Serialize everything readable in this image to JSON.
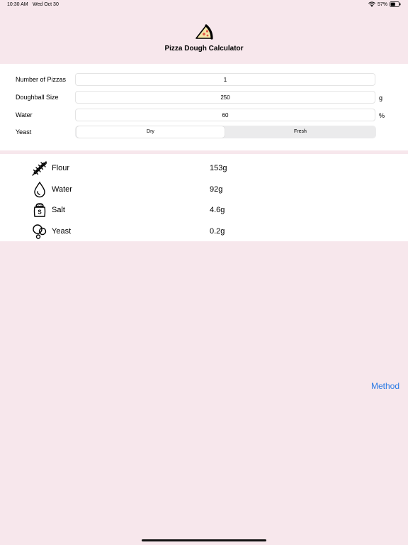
{
  "status_bar": {
    "time": "10:30 AM",
    "date": "Wed Oct 30",
    "battery": "57%",
    "battery_level": 0.57
  },
  "header": {
    "logo_icon": "pizza-slice-icon",
    "title": "Pizza Dough Calculator"
  },
  "form": {
    "pizzas": {
      "label": "Number of Pizzas",
      "value": "1"
    },
    "doughball": {
      "label": "Doughball Size",
      "value": "250",
      "unit": "g"
    },
    "water": {
      "label": "Water",
      "value": "60",
      "unit": "%"
    },
    "yeast": {
      "label": "Yeast",
      "options": [
        "Dry",
        "Fresh"
      ],
      "selected": "Dry"
    }
  },
  "results": [
    {
      "icon": "wheat-icon",
      "name": "Flour",
      "value": "153g"
    },
    {
      "icon": "water-drop-icon",
      "name": "Water",
      "value": "92g"
    },
    {
      "icon": "salt-shaker-icon",
      "name": "Salt",
      "value": "4.6g"
    },
    {
      "icon": "yeast-bubbles-icon",
      "name": "Yeast",
      "value": "0.2g"
    }
  ],
  "method_link": "Method",
  "colors": {
    "background": "#f7e7ec",
    "card": "#ffffff",
    "link": "#2c7be5"
  }
}
